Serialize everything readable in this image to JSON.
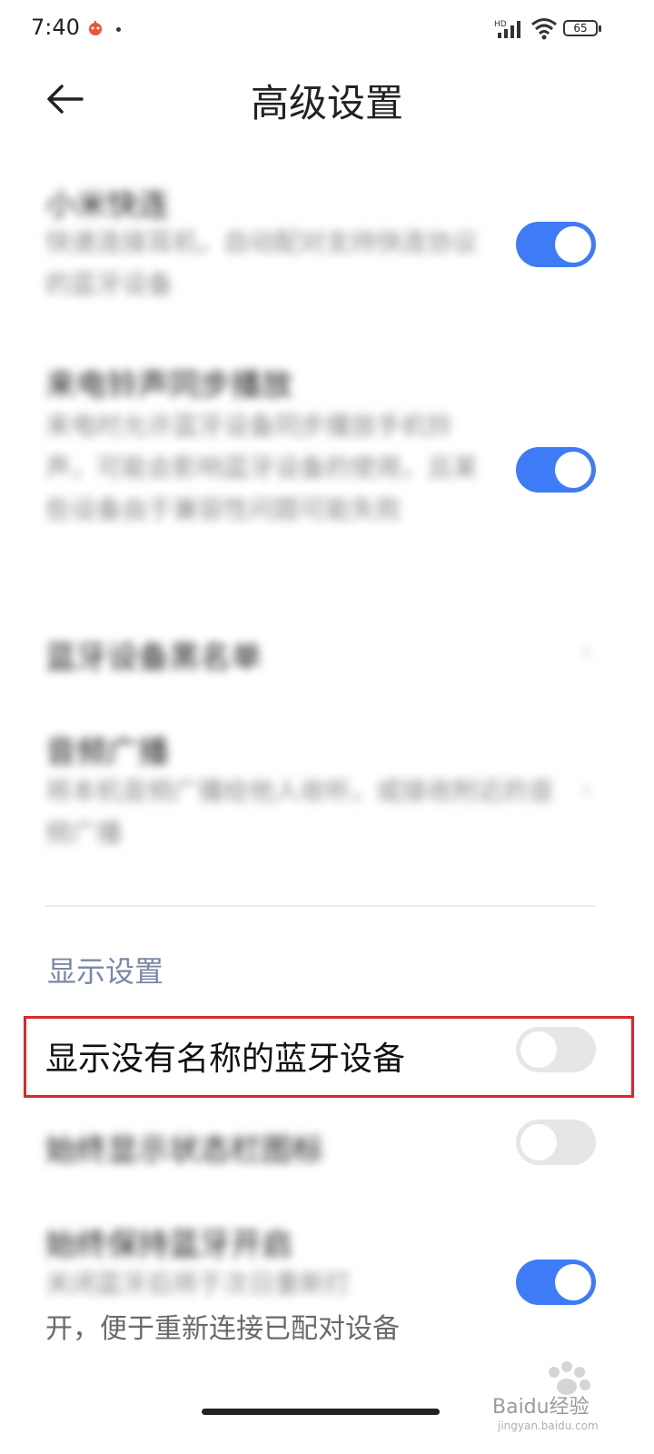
{
  "status_bar": {
    "time": "7:40",
    "battery": "65",
    "network_label": "HD"
  },
  "header": {
    "title": "高级设置"
  },
  "rows": [
    {
      "title": "小米快连",
      "description": "快速连接耳机，自动配对支持快连协议的蓝牙设备",
      "toggle": "on"
    },
    {
      "title": "来电铃声同步播放",
      "description": "来电时允许蓝牙设备同步播放手机铃声，可能会影响蓝牙设备的使用，且某些设备由于兼容性问题可能失败",
      "toggle": "on"
    },
    {
      "title": "蓝牙设备黑名单",
      "control": "chevron"
    },
    {
      "title": "音频广播",
      "description": "将本机音频广播给他人收听，或接收附近的音频广播",
      "control": "chevron"
    }
  ],
  "display_section": {
    "header": "显示设置",
    "items": [
      {
        "title": "显示没有名称的蓝牙设备",
        "toggle": "off"
      },
      {
        "title": "始终显示状态栏图标",
        "toggle": "off"
      },
      {
        "title": "始终保持蓝牙开启",
        "description_line1": "关闭蓝牙后将于次日重新打",
        "description_line2": "开，便于重新连接已配对设备",
        "toggle": "on"
      }
    ]
  },
  "watermark": {
    "text": "Baidu经验",
    "url": "jingyan.baidu.com"
  },
  "colors": {
    "toggle_on": "#3d7bf7",
    "toggle_off": "#e6e6e6",
    "highlight": "#e0222a",
    "section_header": "#7a87a8"
  }
}
